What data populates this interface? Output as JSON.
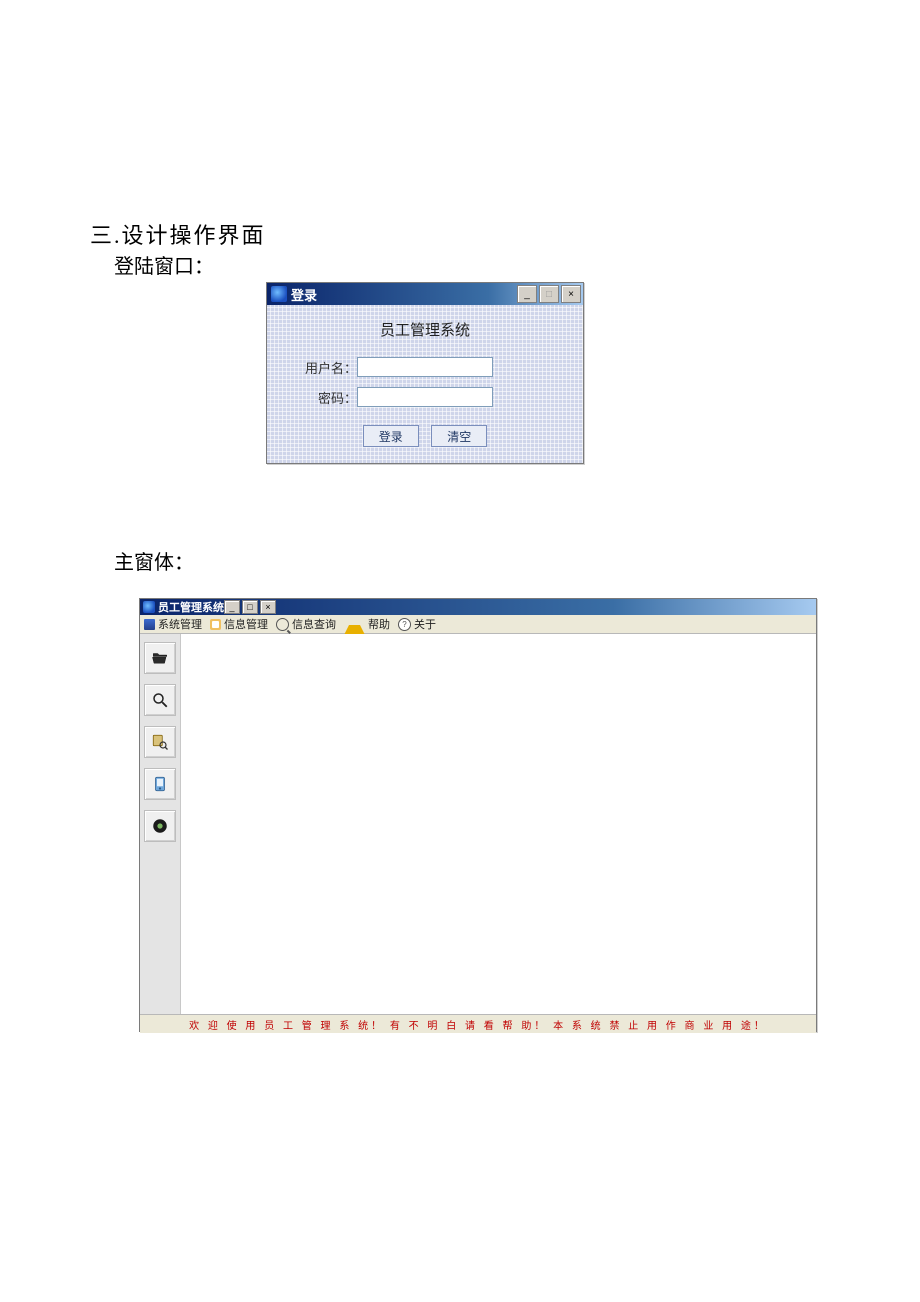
{
  "section": {
    "heading": "三.设计操作界面",
    "login_label": "登陆窗口：",
    "main_label": "主窗体："
  },
  "login_window": {
    "title": "登录",
    "body_title": "员工管理系统",
    "username_label": "用户名：",
    "password_label": "密码：",
    "username_value": "",
    "password_value": "",
    "login_btn": "登录",
    "clear_btn": "清空",
    "win_buttons": {
      "min": "_",
      "max": "□",
      "close": "×"
    }
  },
  "main_window": {
    "title": "员工管理系统",
    "menu": [
      {
        "icon": "sys",
        "label": "系统管理"
      },
      {
        "icon": "info",
        "label": "信息管理"
      },
      {
        "icon": "query",
        "label": "信息查询"
      },
      {
        "icon": "help",
        "label": "帮助"
      },
      {
        "icon": "about",
        "label": "关于"
      }
    ],
    "toolbar_icons": [
      "folder-open-icon",
      "search-icon",
      "user-search-icon",
      "device-icon",
      "record-icon"
    ],
    "status_text": "欢 迎 使 用 员 工 管 理 系 统！    有 不 明 白 请 看 帮 助！    本 系 统 禁 止 用 作 商 业 用 途！",
    "win_buttons": {
      "min": "_",
      "max": "□",
      "close": "×"
    }
  }
}
